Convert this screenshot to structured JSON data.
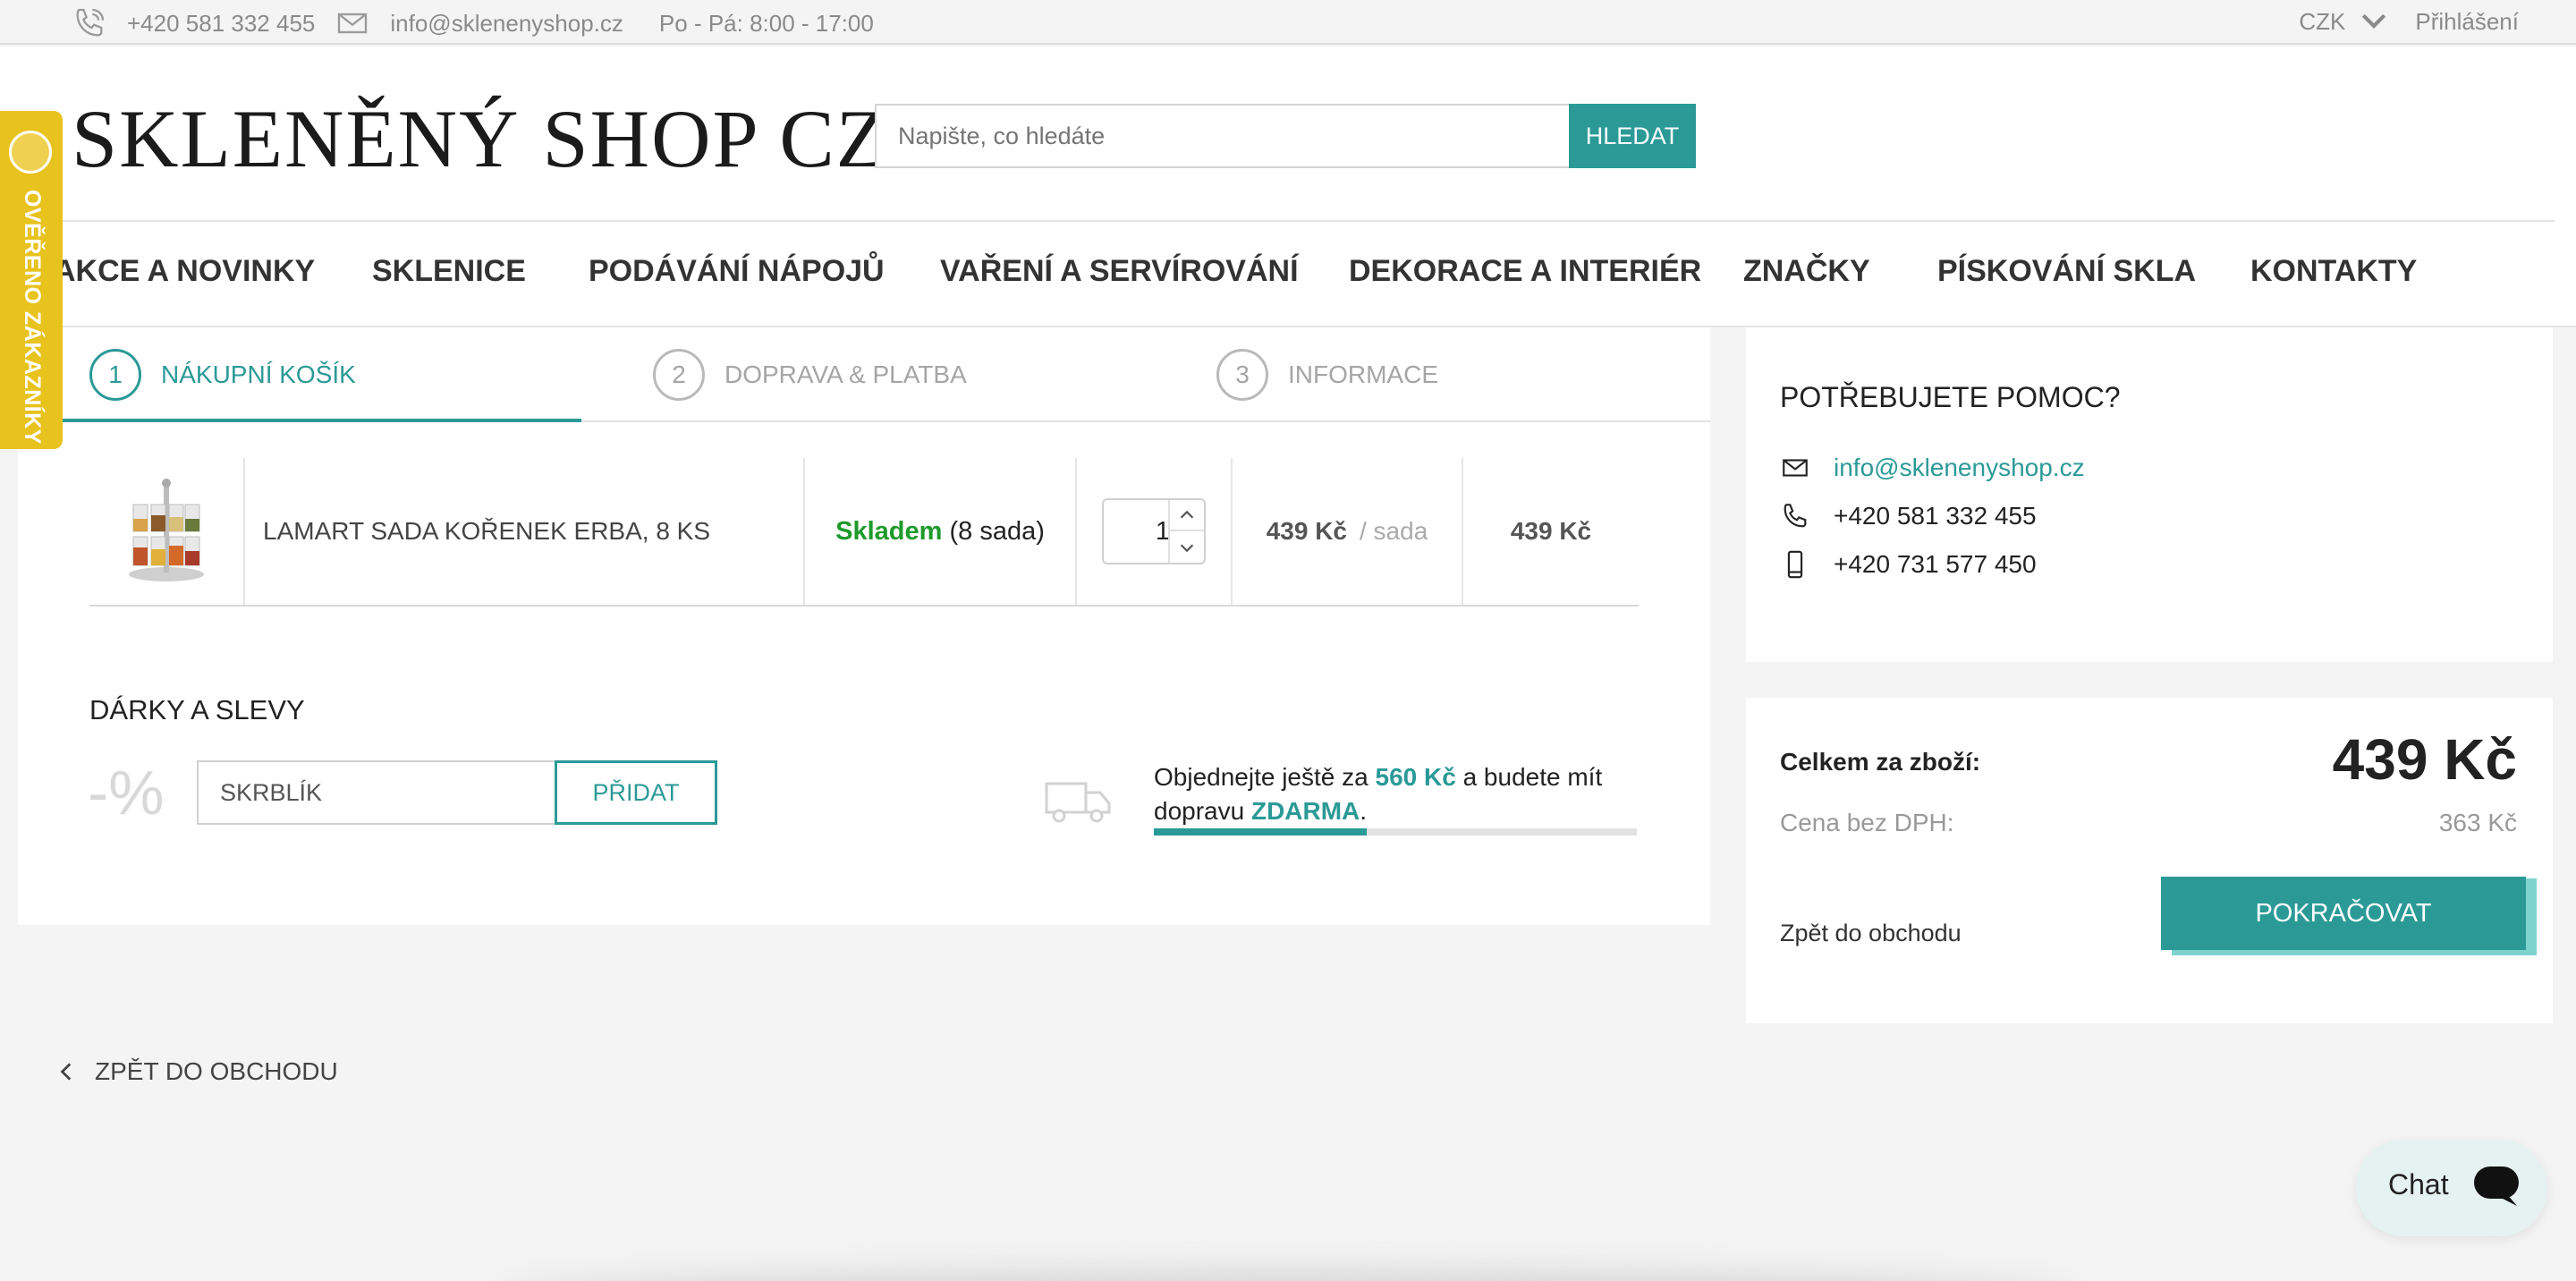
{
  "topbar": {
    "phone": "+420 581 332 455",
    "email": "info@sklenenyshop.cz",
    "hours": "Po - Pá: 8:00 - 17:00",
    "currency": "CZK",
    "login": "Přihlášení"
  },
  "header": {
    "logo": "SKLENĚNÝ SHOP CZ",
    "search_placeholder": "Napište, co hledáte",
    "search_button": "HLEDAT"
  },
  "badge": {
    "text": "OVĚŘENO ZÁKAZNÍKY"
  },
  "nav": [
    "AKCE A NOVINKY",
    "SKLENICE",
    "PODÁVÁNÍ NÁPOJŮ",
    "VAŘENÍ A SERVÍROVÁNÍ",
    "DEKORACE A INTERIÉR",
    "ZNAČKY",
    "PÍSKOVÁNÍ SKLA",
    "KONTAKTY"
  ],
  "steps": [
    {
      "num": "1",
      "label": "NÁKUPNÍ KOŠÍK",
      "active": true
    },
    {
      "num": "2",
      "label": "DOPRAVA & PLATBA",
      "active": false
    },
    {
      "num": "3",
      "label": "INFORMACE",
      "active": false
    }
  ],
  "cart_item": {
    "name": "LAMART SADA KOŘENEK ERBA, 8 KS",
    "stock_status": "Skladem",
    "stock_qty": "(8 sada)",
    "quantity": "1",
    "unit_price": "439 Kč",
    "unit": "/ sada",
    "total": "439 Kč"
  },
  "gifts": {
    "title": "DÁRKY A SLEVY",
    "percent_icon": "-%",
    "coupon_value": "SKRBLÍK",
    "add_button": "PŘIDAT"
  },
  "shipping": {
    "text_1": "Objednejte ještě za",
    "amount": "560 Kč",
    "text_2": "a budete mít dopravu",
    "free": "ZDARMA",
    "progress": 0.44
  },
  "help": {
    "title": "POTŘEBUJETE POMOC?",
    "email": "info@sklenenyshop.cz",
    "phone": "+420 581 332 455",
    "mobile": "+420 731 577 450"
  },
  "summary": {
    "total_label": "Celkem za zboží:",
    "total": "439 Kč",
    "vat_label": "Cena bez DPH:",
    "vat_value": "363 Kč",
    "back": "Zpět do obchodu",
    "continue": "POKRAČOVAT"
  },
  "back_link": "ZPĚT DO OBCHODU",
  "chat": {
    "label": "Chat"
  },
  "colors": {
    "accent": "#2b9a97",
    "stock": "#1e9a2b",
    "badge": "#e8c21d"
  }
}
